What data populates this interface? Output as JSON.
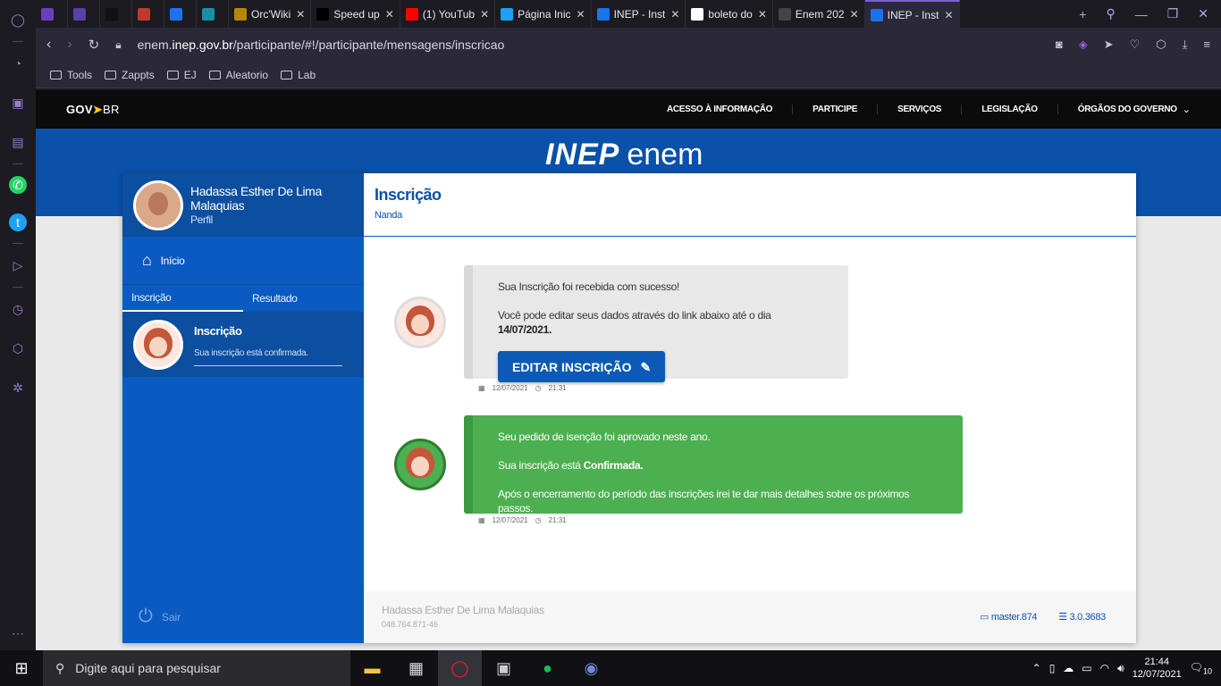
{
  "browser": {
    "tabs": [
      {
        "label": "",
        "icon_color": "#6a3fbf",
        "icon": "controller-icon"
      },
      {
        "label": "",
        "icon_color": "#5b3fa8",
        "icon": "bot-icon"
      },
      {
        "label": "",
        "icon_color": "#111111",
        "icon": "notion-icon"
      },
      {
        "label": "",
        "icon_color": "#c0392b",
        "icon": "gmail-icon"
      },
      {
        "label": "",
        "icon_color": "#1a73e8",
        "icon": "calendar-icon"
      },
      {
        "label": "",
        "icon_color": "#1a8fa0",
        "icon": "app-icon"
      },
      {
        "label": "Orc'Wiki",
        "icon_color": "#b8860b",
        "icon": "wiki-icon"
      },
      {
        "label": "Speed up",
        "icon_color": "#000000",
        "icon": "dev-icon"
      },
      {
        "label": "(1) YouTub",
        "icon_color": "#ff0000",
        "icon": "youtube-icon"
      },
      {
        "label": "Página Inic",
        "icon_color": "#1da1f2",
        "icon": "twitter-icon"
      },
      {
        "label": "INEP - Inst",
        "icon_color": "#1a73e8",
        "icon": "ie-icon"
      },
      {
        "label": "boleto do",
        "icon_color": "#ffffff",
        "icon": "google-icon"
      },
      {
        "label": "Enem 202",
        "icon_color": "#444444",
        "icon": "em-icon"
      },
      {
        "label": "INEP - Inst",
        "icon_color": "#1a73e8",
        "icon": "ie-icon",
        "active": true
      }
    ],
    "url_prefix": "enem.",
    "url_domain": "inep.gov.br",
    "url_path": "/participante/#!/participante/mensagens/inscricao",
    "bookmarks": [
      "Tools",
      "Zappts",
      "EJ",
      "Aleatorio",
      "Lab"
    ]
  },
  "gov": {
    "logo_gov": "GOV",
    "logo_br": "BR",
    "nav": [
      "ACESSO À INFORMAÇÃO",
      "PARTICIPE",
      "SERVIÇOS",
      "LEGISLAÇÃO",
      "ÓRGÃOS DO GOVERNO"
    ]
  },
  "banner": {
    "inep": "INEP",
    "enem": "enem"
  },
  "sidebar": {
    "user_name": "Hadassa Esther De Lima Malaquias",
    "profile_label": "Perfil",
    "home_label": "Início",
    "tabs": [
      "Inscrição",
      "Resultado"
    ],
    "item_title": "Inscrição",
    "item_subtitle": "Sua inscrição está confirmada.",
    "logout_label": "Sair"
  },
  "main": {
    "title": "Inscrição",
    "subtitle": "Nanda",
    "msg1": {
      "line1": "Sua Inscrição foi recebida com sucesso!",
      "line2_pre": "Você pode editar seus dados através do link abaixo até o dia ",
      "line2_date": "14/07/2021.",
      "button": "EDITAR INSCRIÇÃO",
      "date": "12/07/2021",
      "time": "21:31"
    },
    "msg2": {
      "line1": "Seu pedido de isenção foi aprovado neste ano.",
      "line2_pre": "Sua inscrição está ",
      "line2_bold": "Confirmada.",
      "line3": "Após o encerramento do período das inscrições irei te dar mais detalhes sobre os próximos passos.",
      "date": "12/07/2021",
      "time": "21:31"
    },
    "footer": {
      "name": "Hadassa Esther De Lima Malaquias",
      "cpf": "048.764.871-46",
      "branch": "master.874",
      "version": "3.0.3683"
    }
  },
  "taskbar": {
    "search_placeholder": "Digite aqui para pesquisar",
    "time": "21:44",
    "date": "12/07/2021",
    "notifications": "10"
  }
}
